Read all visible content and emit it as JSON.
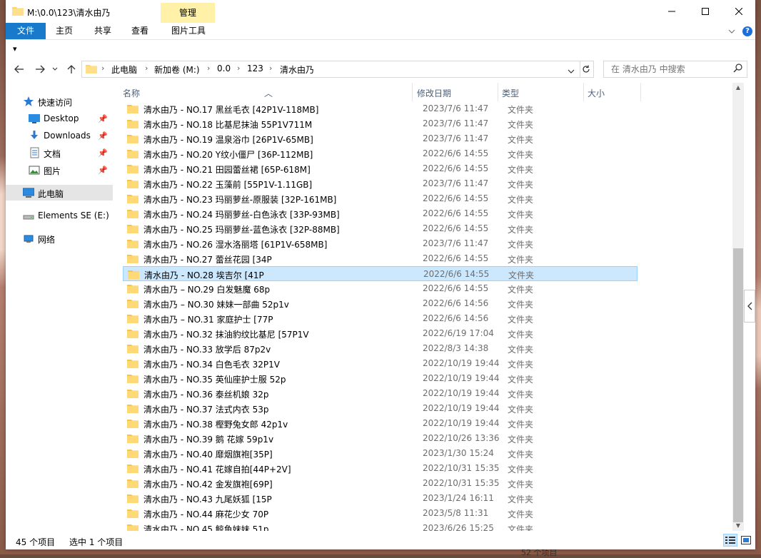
{
  "window": {
    "title": "M:\\0.0\\123\\清水由乃",
    "context_tab": "管理",
    "min_icon": "minimize-icon",
    "max_icon": "maximize-icon",
    "close_icon": "close-icon"
  },
  "ribbon": {
    "tabs": [
      "文件",
      "主页",
      "共享",
      "查看",
      "图片工具"
    ],
    "help_label": "?"
  },
  "qat_label": "▾",
  "address": {
    "crumbs": [
      "此电脑",
      "新加卷 (M:)",
      "0.0",
      "123",
      "清水由乃"
    ],
    "separator": "›"
  },
  "search": {
    "placeholder": "在 清水由乃 中搜索"
  },
  "sidebar": {
    "items": [
      {
        "label": "快速访问",
        "icon": "star-icon"
      },
      {
        "label": "Desktop",
        "icon": "desktop-icon",
        "pin": "📌"
      },
      {
        "label": "Downloads",
        "icon": "download-icon",
        "pin": "📌"
      },
      {
        "label": "文档",
        "icon": "document-icon",
        "pin": "📌"
      },
      {
        "label": "图片",
        "icon": "picture-icon",
        "pin": "📌"
      },
      {
        "label": "此电脑",
        "icon": "computer-icon"
      },
      {
        "label": "Elements SE (E:)",
        "icon": "drive-icon"
      },
      {
        "label": "网络",
        "icon": "network-icon"
      }
    ]
  },
  "columns": {
    "name": "名称",
    "date": "修改日期",
    "type": "类型",
    "size": "大小"
  },
  "files": [
    {
      "name": "清水由乃 - NO.17 黑丝毛衣 [42P1V-118MB]",
      "date": "2023/7/6 11:47",
      "type": "文件夹"
    },
    {
      "name": "清水由乃 - NO.18 比基尼抹油 55P1V711M",
      "date": "2023/7/6 11:47",
      "type": "文件夹"
    },
    {
      "name": "清水由乃 - NO.19 温泉浴巾 [26P1V-65MB]",
      "date": "2023/7/6 11:47",
      "type": "文件夹"
    },
    {
      "name": "清水由乃 - NO.20 Y纹小僵尸 [36P-112MB]",
      "date": "2022/6/6 14:55",
      "type": "文件夹"
    },
    {
      "name": "清水由乃 - NO.21 田园蕾丝裙 [65P-618M]",
      "date": "2022/6/6 14:55",
      "type": "文件夹"
    },
    {
      "name": "清水由乃 - NO.22 玉藻前 [55P1V-1.11GB]",
      "date": "2023/7/6 11:47",
      "type": "文件夹"
    },
    {
      "name": "清水由乃 - NO.23 玛丽萝丝-原服装 [32P-161MB]",
      "date": "2022/6/6 14:55",
      "type": "文件夹"
    },
    {
      "name": "清水由乃 - NO.24 玛丽萝丝-白色泳衣 [33P-93MB]",
      "date": "2022/6/6 14:55",
      "type": "文件夹"
    },
    {
      "name": "清水由乃 - NO.25 玛丽萝丝-蓝色泳衣 [32P-88MB]",
      "date": "2022/6/6 14:55",
      "type": "文件夹"
    },
    {
      "name": "清水由乃 - NO.26 湿水洛丽塔 [61P1V-658MB]",
      "date": "2023/7/6 11:47",
      "type": "文件夹"
    },
    {
      "name": "清水由乃 - NO.27 蕾丝花园 [34P",
      "date": "2022/6/6 14:55",
      "type": "文件夹"
    },
    {
      "name": "清水由乃 - NO.28 埃吉尔 [41P",
      "date": "2022/6/6 14:55",
      "type": "文件夹",
      "selected": true
    },
    {
      "name": "清水由乃 – NO.29 白发魅魔 68p",
      "date": "2022/6/6 14:55",
      "type": "文件夹"
    },
    {
      "name": "清水由乃 – NO.30 妹妹一部曲 52p1v",
      "date": "2022/6/6 14:56",
      "type": "文件夹"
    },
    {
      "name": "清水由乃 – NO.31 家庭护士 [77P",
      "date": "2022/6/6 14:56",
      "type": "文件夹"
    },
    {
      "name": "清水由乃 - NO.32 抹油豹纹比基尼 [57P1V",
      "date": "2022/6/19 17:04",
      "type": "文件夹"
    },
    {
      "name": "清水由乃 - NO.33 放学后 87p2v",
      "date": "2022/8/3 14:38",
      "type": "文件夹"
    },
    {
      "name": "清水由乃 - NO.34 白色毛衣 32P1V",
      "date": "2022/10/19 19:44",
      "type": "文件夹"
    },
    {
      "name": "清水由乃 - NO.35 英仙座护士服 52p",
      "date": "2022/10/19 19:44",
      "type": "文件夹"
    },
    {
      "name": "清水由乃 - NO.36 泰丝机娘 32p",
      "date": "2022/10/19 19:44",
      "type": "文件夹"
    },
    {
      "name": "清水由乃 - NO.37 法式内衣 53p",
      "date": "2022/10/19 19:44",
      "type": "文件夹"
    },
    {
      "name": "清水由乃 - NO.38 樫野兔女郎 42p1v",
      "date": "2022/10/19 19:44",
      "type": "文件夹"
    },
    {
      "name": "清水由乃 - NO.39 鹅 花嫁 59p1v",
      "date": "2022/10/26 13:36",
      "type": "文件夹"
    },
    {
      "name": "清水由乃 - NO.40 靡烟旗袍[35P]",
      "date": "2023/1/30 15:24",
      "type": "文件夹"
    },
    {
      "name": "清水由乃 - NO.41 花嫁自拍[44P+2V]",
      "date": "2022/10/31 15:35",
      "type": "文件夹"
    },
    {
      "name": "清水由乃 - NO.42 金发旗袍[69P]",
      "date": "2022/10/31 15:35",
      "type": "文件夹"
    },
    {
      "name": "清水由乃 - NO.43 九尾妖狐 [15P",
      "date": "2023/1/24 16:11",
      "type": "文件夹"
    },
    {
      "name": "清水由乃 - NO.44 麻花少女 70P",
      "date": "2023/5/8 11:31",
      "type": "文件夹"
    },
    {
      "name": "清水由乃 - NO.45 鲸鱼妹妹 51p",
      "date": "2023/6/26 15:25",
      "type": "文件夹"
    }
  ],
  "status": {
    "count": "45 个项目",
    "selected": "选中 1 个项目"
  },
  "behind_text": "52 个项目",
  "colors": {
    "accent": "#1979ca",
    "selection": "#cce8ff",
    "context_tab": "#fff2a8",
    "folder": "#ffd26a"
  }
}
